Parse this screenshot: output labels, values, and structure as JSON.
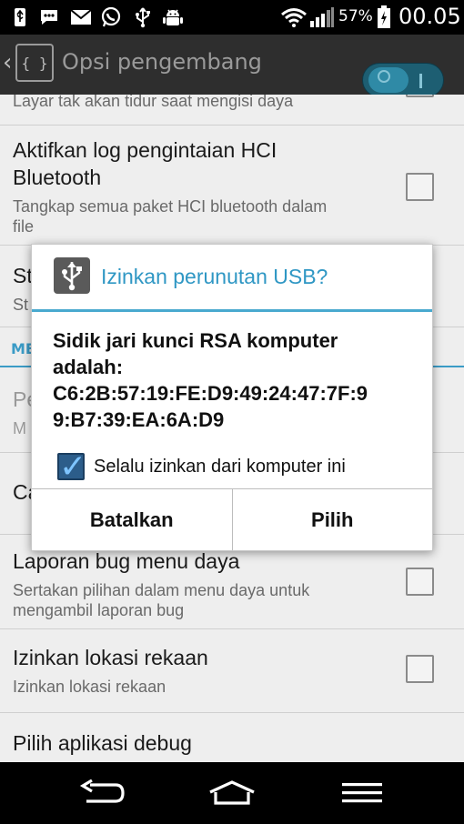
{
  "status_bar": {
    "icons": [
      "usb-icon",
      "chat-icon",
      "gmail-icon",
      "whatsapp-icon",
      "usb-debug-icon",
      "android-debug-icon",
      "wifi-icon",
      "signal-icon",
      "battery-icon"
    ],
    "battery_percent": "57%",
    "time": "00.05"
  },
  "action_bar": {
    "title": "Opsi pengembang",
    "app_icon_glyph": "{ }",
    "toggle_on": true
  },
  "list": {
    "top_partial_subtitle": "Layar tak akan tidur saat mengisi daya",
    "items": [
      {
        "title_line1": "Aktifkan log pengintaian HCI",
        "title_line2": "Bluetooth",
        "subtitle_line1": "Tangkap semua paket HCI bluetooth dalam",
        "subtitle_line2": "file",
        "checked": false
      },
      {
        "title": "St",
        "subtitle": "St"
      },
      {
        "section": "ME"
      },
      {
        "title": "Pe",
        "subtitle": "M"
      },
      {
        "title": "Ca"
      },
      {
        "title": "Laporan bug menu daya",
        "subtitle_line1": "Sertakan pilihan dalam menu daya untuk",
        "subtitle_line2": "mengambil laporan bug",
        "checked": false
      },
      {
        "title": "Izinkan lokasi rekaan",
        "subtitle": "Izinkan lokasi rekaan",
        "checked": false
      },
      {
        "title": "Pilih aplikasi debug"
      }
    ]
  },
  "dialog": {
    "title": "Izinkan perunutan USB?",
    "message": "Sidik jari kunci RSA komputer adalah: C6:2B:57:19:FE:D9:49:24:47:7F:99:B7:39:EA:6A:D9",
    "message_line1": "Sidik jari kunci RSA komputer",
    "message_line2": "adalah:",
    "message_line3": "C6:2B:57:19:FE:D9:49:24:47:7F:9",
    "message_line4": "9:B7:39:EA:6A:D9",
    "always_allow_label": "Selalu izinkan dari komputer ini",
    "always_allow_checked": true,
    "cancel_label": "Batalkan",
    "ok_label": "Pilih"
  },
  "nav_bar": {
    "buttons": [
      "back-icon",
      "home-icon",
      "menu-icon"
    ]
  },
  "colors": {
    "accent": "#2f97c4",
    "status_bar_bg": "#000000",
    "action_bar_bg": "#2e2e2e",
    "list_bg": "#eeeeee"
  }
}
